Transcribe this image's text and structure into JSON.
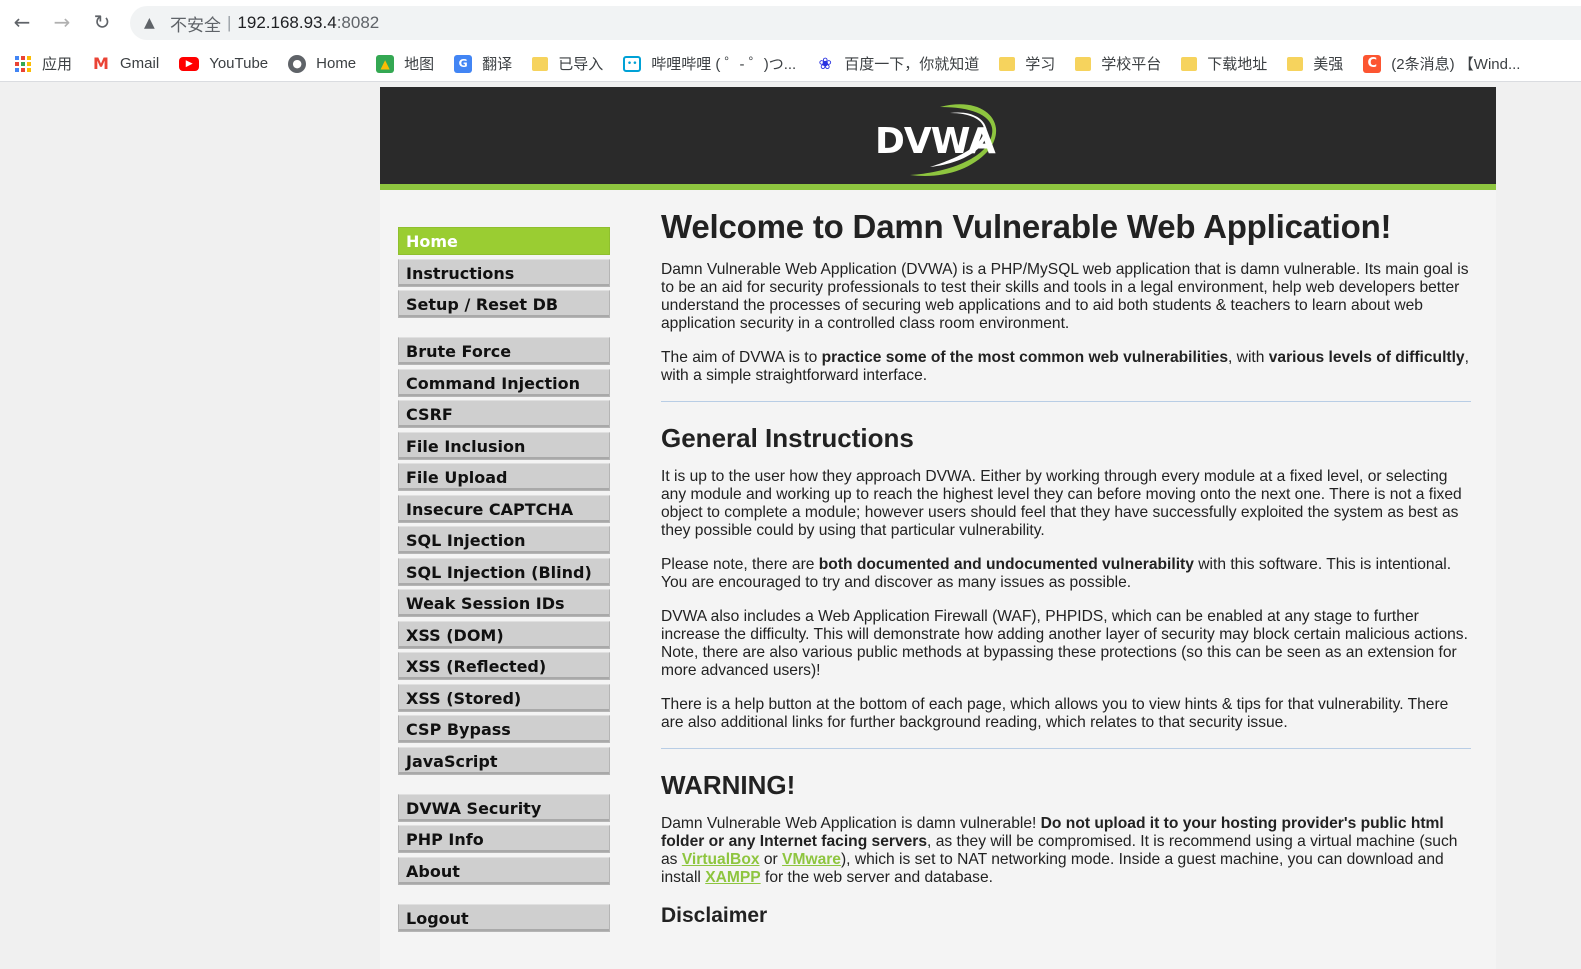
{
  "browser": {
    "insecure_label": "不安全",
    "separator": "|",
    "url_host": "192.168.93.4",
    "url_port": ":8082",
    "bookmarks": [
      {
        "label": "应用",
        "icon": "apps-grid-icon"
      },
      {
        "label": "Gmail",
        "icon": "gmail-icon"
      },
      {
        "label": "YouTube",
        "icon": "youtube-icon"
      },
      {
        "label": "Home",
        "icon": "globe-icon"
      },
      {
        "label": "地图",
        "icon": "maps-icon"
      },
      {
        "label": "翻译",
        "icon": "translate-icon"
      },
      {
        "label": "已导入",
        "icon": "folder-icon"
      },
      {
        "label": "哔哩哔哩 ( ゜- ゜)つ...",
        "icon": "bilibili-icon"
      },
      {
        "label": "百度一下，你就知道",
        "icon": "baidu-icon"
      },
      {
        "label": "学习",
        "icon": "folder-icon"
      },
      {
        "label": "学校平台",
        "icon": "folder-icon"
      },
      {
        "label": "下载地址",
        "icon": "folder-icon"
      },
      {
        "label": "美强",
        "icon": "folder-icon"
      },
      {
        "label": "(2条消息) 【Wind...",
        "icon": "csdn-icon"
      }
    ]
  },
  "logo": {
    "text": "DVWA"
  },
  "menu": {
    "group1": [
      "Home",
      "Instructions",
      "Setup / Reset DB"
    ],
    "group2": [
      "Brute Force",
      "Command Injection",
      "CSRF",
      "File Inclusion",
      "File Upload",
      "Insecure CAPTCHA",
      "SQL Injection",
      "SQL Injection (Blind)",
      "Weak Session IDs",
      "XSS (DOM)",
      "XSS (Reflected)",
      "XSS (Stored)",
      "CSP Bypass",
      "JavaScript"
    ],
    "group3": [
      "DVWA Security",
      "PHP Info",
      "About"
    ],
    "group4": [
      "Logout"
    ]
  },
  "content": {
    "title": "Welcome to Damn Vulnerable Web Application!",
    "intro": "Damn Vulnerable Web Application (DVWA) is a PHP/MySQL web application that is damn vulnerable. Its main goal is to be an aid for security professionals to test their skills and tools in a legal environment, help web developers better understand the processes of securing web applications and to aid both students & teachers to learn about web application security in a controlled class room environment.",
    "aim_pre": "The aim of DVWA is to ",
    "aim_b1": "practice some of the most common web vulnerabilities",
    "aim_mid": ", with ",
    "aim_b2": "various levels of difficultly",
    "aim_post": ", with a simple straightforward interface.",
    "general_heading": "General Instructions",
    "general_p1": "It is up to the user how they approach DVWA. Either by working through every module at a fixed level, or selecting any module and working up to reach the highest level they can before moving onto the next one. There is not a fixed object to complete a module; however users should feel that they have successfully exploited the system as best as they possible could by using that particular vulnerability.",
    "note_pre": "Please note, there are ",
    "note_b": "both documented and undocumented vulnerability",
    "note_post": " with this software. This is intentional. You are encouraged to try and discover as many issues as possible.",
    "waf_p": "DVWA also includes a Web Application Firewall (WAF), PHPIDS, which can be enabled at any stage to further increase the difficulty. This will demonstrate how adding another layer of security may block certain malicious actions. Note, there are also various public methods at bypassing these protections (so this can be seen as an extension for more advanced users)!",
    "help_p": "There is a help button at the bottom of each page, which allows you to view hints & tips for that vulnerability. There are also additional links for further background reading, which relates to that security issue.",
    "warning_heading": "WARNING!",
    "warn_pre": "Damn Vulnerable Web Application is damn vulnerable! ",
    "warn_b": "Do not upload it to your hosting provider's public html folder or any Internet facing servers",
    "warn_mid1": ", as they will be compromised. It is recommend using a virtual machine (such as ",
    "link_virtualbox": "VirtualBox",
    "warn_or": " or ",
    "link_vmware": "VMware",
    "warn_mid2": "), which is set to NAT networking mode. Inside a guest machine, you can download and install ",
    "link_xampp": "XAMPP",
    "warn_post": " for the web server and database.",
    "disclaimer_heading": "Disclaimer"
  },
  "colors": {
    "accent": "#8ec53f",
    "header_bg": "#2a2a2a",
    "menu_bg": "#cfcfcf",
    "selected_bg": "#9acd32"
  }
}
